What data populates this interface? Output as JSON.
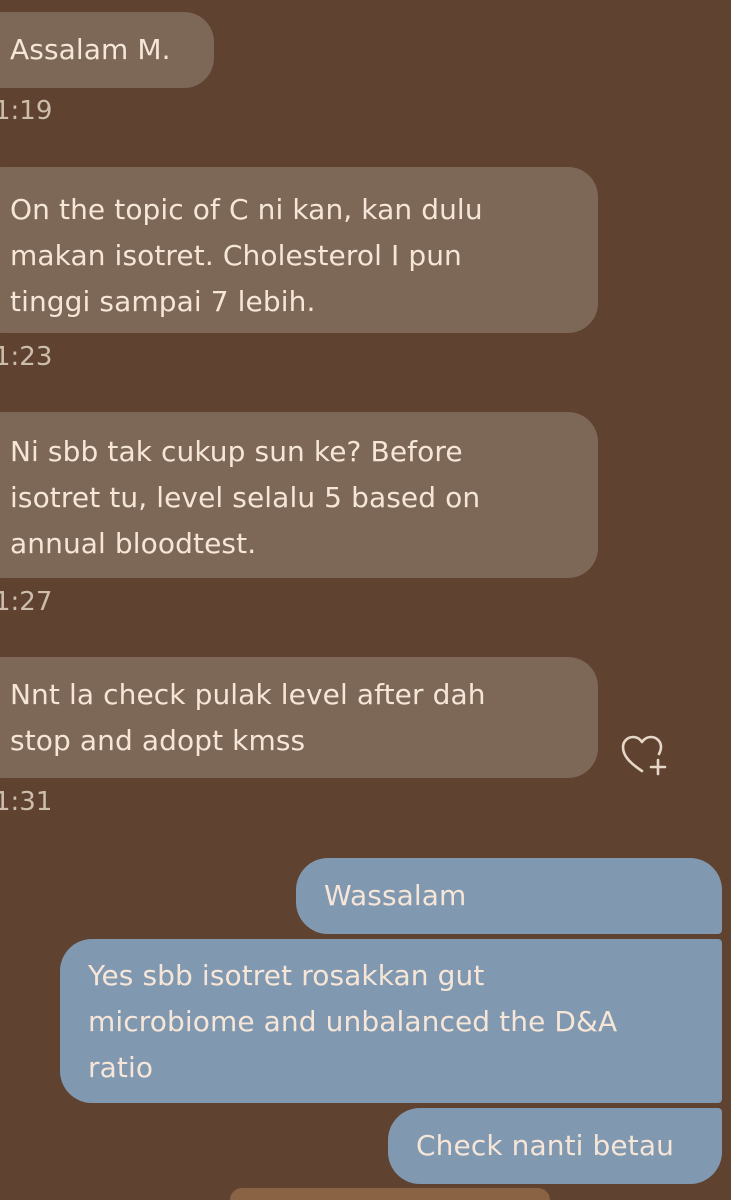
{
  "colors": {
    "background": "#5f4330",
    "incoming_bubble": "#7d6757",
    "outgoing_bubble": "#8198b1",
    "bubble_text": "#f6e6d8",
    "timestamp_text": "#cdbdac"
  },
  "messages": {
    "incoming": [
      {
        "text": "Assalam M.",
        "time": "1:19"
      },
      {
        "lines": [
          "On the topic of C ni kan, kan dulu",
          "makan isotret. Cholesterol I pun",
          "tinggi sampai 7 lebih."
        ],
        "time": "1:23"
      },
      {
        "lines": [
          "Ni sbb tak cukup sun ke? Before",
          "isotret tu, level selalu 5 based on",
          "annual bloodtest."
        ],
        "time": "1:27"
      },
      {
        "lines": [
          "Nnt la check pulak level after dah",
          "stop and adopt kmss"
        ],
        "time": "1:31"
      }
    ],
    "outgoing": [
      {
        "text": "Wassalam"
      },
      {
        "lines": [
          "Yes sbb isotret rosakkan gut",
          "microbiome and unbalanced the D&A",
          "ratio"
        ]
      },
      {
        "text": "Check nanti betau"
      }
    ]
  },
  "icons": {
    "reaction": "heart-plus-icon"
  }
}
